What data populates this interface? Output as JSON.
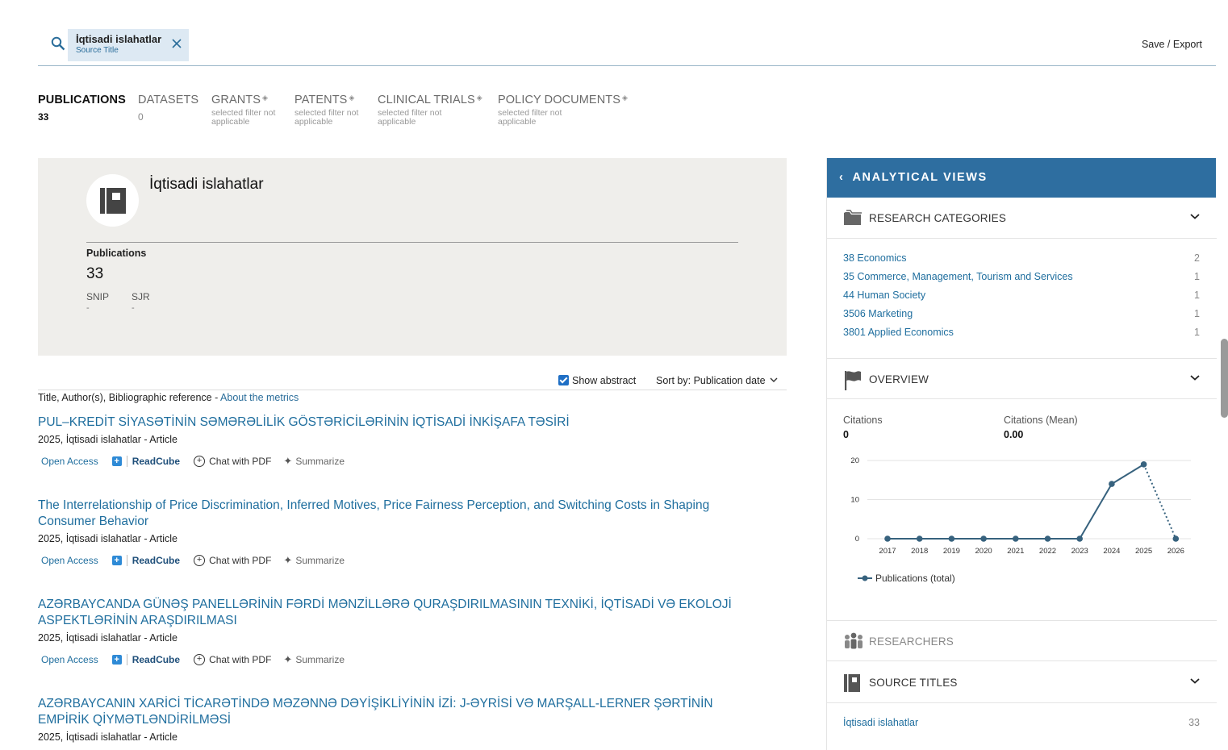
{
  "search": {
    "chip_title": "İqtisadi islahatlar",
    "chip_subtitle": "Source Title",
    "save_export": "Save / Export"
  },
  "tabs": [
    {
      "label": "PUBLICATIONS",
      "count": "33",
      "note": ""
    },
    {
      "label": "DATASETS",
      "count": "0",
      "note": ""
    },
    {
      "label": "GRANTS",
      "count": "",
      "note": "selected filter not applicable"
    },
    {
      "label": "PATENTS",
      "count": "",
      "note": "selected filter not applicable"
    },
    {
      "label": "CLINICAL TRIALS",
      "count": "",
      "note": "selected filter not applicable"
    },
    {
      "label": "POLICY DOCUMENTS",
      "count": "",
      "note": "selected filter not applicable"
    }
  ],
  "source": {
    "name": "İqtisadi islahatlar",
    "publications_label": "Publications",
    "publications_value": "33",
    "snip_label": "SNIP",
    "snip_value": "-",
    "sjr_label": "SJR",
    "sjr_value": "-"
  },
  "list": {
    "show_abstract": "Show abstract",
    "sort_by": "Sort by:",
    "sort_value": "Publication date",
    "subhead": "Title, Author(s), Bibliographic reference - ",
    "about_metrics": "About the metrics"
  },
  "actions": {
    "open_access": "Open Access",
    "readcube": "ReadCube",
    "chat_pdf": "Chat with PDF",
    "summarize": "Summarize"
  },
  "publications": [
    {
      "title": "PUL–KREDİT SİYASƏTİNİN SƏMƏRƏLİLİK GÖSTƏRİCİLƏRİNİN İQTİSADİ İNKİŞAFA TƏSİRİ",
      "meta": "2025, İqtisadi islahatlar - Article"
    },
    {
      "title": "The Interrelationship of Price Discrimination, Inferred Motives, Price Fairness Perception, and Switching Costs in Shaping Consumer Behavior",
      "meta": "2025, İqtisadi islahatlar - Article"
    },
    {
      "title": "AZƏRBAYCANDA GÜNƏŞ PANELLƏRİNİN FƏRDİ MƏNZİLLƏRƏ QURAŞDIRILMASININ TEXNİKİ, İQTİSADİ VƏ EKOLOJİ ASPEKTLƏRİNİN ARAŞDIRILMASI",
      "meta": "2025, İqtisadi islahatlar - Article"
    },
    {
      "title": "AZƏRBAYCANIN XARİCİ TİCARƏTİNDƏ MƏZƏNNƏ DƏYİŞİKLİYİNİN İZİ: J-ƏYRİSİ VƏ MARŞALL-LERNER ŞƏRTİNİN EMPİRİK QİYMƏTLƏNDİRİLMƏSİ",
      "meta": "2025, İqtisadi islahatlar - Article"
    }
  ],
  "panel": {
    "title": "ANALYTICAL VIEWS",
    "research_categories": {
      "title": "RESEARCH CATEGORIES",
      "items": [
        {
          "label": "38 Economics",
          "count": "2"
        },
        {
          "label": "35 Commerce, Management, Tourism and Services",
          "count": "1"
        },
        {
          "label": "44 Human Society",
          "count": "1"
        },
        {
          "label": "3506 Marketing",
          "count": "1"
        },
        {
          "label": "3801 Applied Economics",
          "count": "1"
        }
      ]
    },
    "overview": {
      "title": "OVERVIEW",
      "citations_label": "Citations",
      "citations_value": "0",
      "mean_label": "Citations (Mean)",
      "mean_value": "0.00"
    },
    "researchers": {
      "title": "RESEARCHERS"
    },
    "source_titles": {
      "title": "SOURCE TITLES",
      "items": [
        {
          "label": "İqtisadi islahatlar",
          "count": "33"
        }
      ]
    }
  },
  "chart_data": {
    "type": "line",
    "x": [
      "2017",
      "2018",
      "2019",
      "2020",
      "2021",
      "2022",
      "2023",
      "2024",
      "2025",
      "2026"
    ],
    "series": [
      {
        "name": "Publications (total)",
        "values": [
          0,
          0,
          0,
          0,
          0,
          0,
          0,
          14,
          19,
          0
        ]
      }
    ],
    "dotted_segment_from_index": 8,
    "yticks": [
      0,
      10,
      20
    ],
    "ylim": [
      0,
      20
    ],
    "grid": true,
    "legend": "bottom-left",
    "color": "#37627e"
  },
  "colors": {
    "accent": "#2e6ea0",
    "link": "#1f6e9e",
    "chip_bg": "#dde9f3",
    "card_bg": "#efeeeb"
  }
}
